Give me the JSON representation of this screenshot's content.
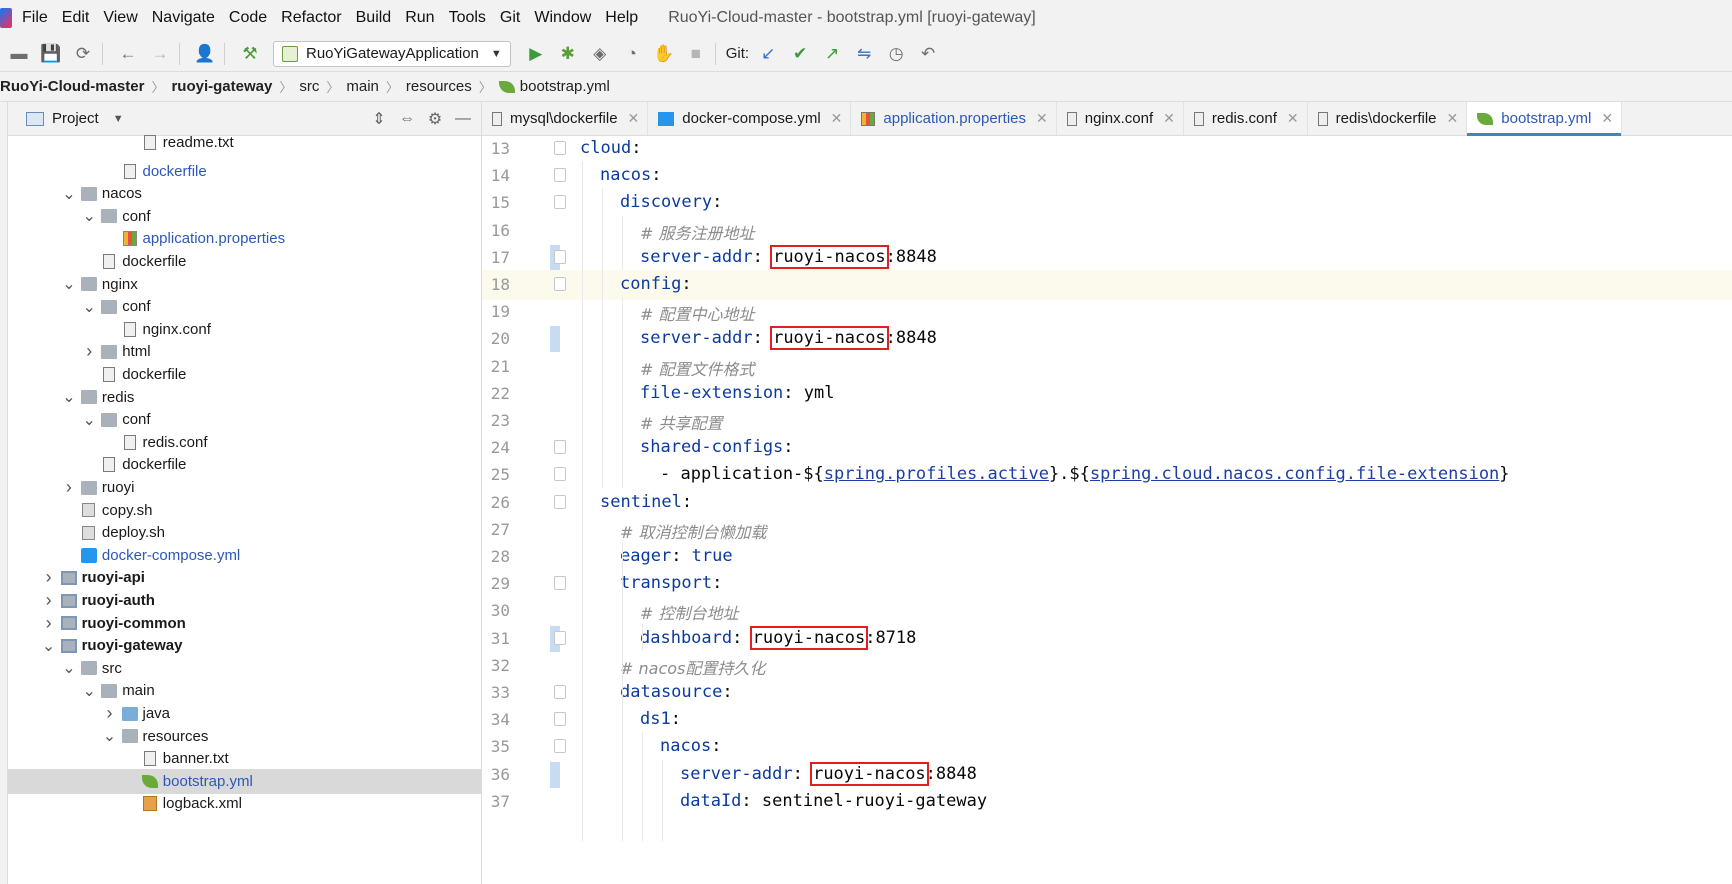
{
  "menu": [
    "File",
    "Edit",
    "View",
    "Navigate",
    "Code",
    "Refactor",
    "Build",
    "Run",
    "Tools",
    "Git",
    "Window",
    "Help"
  ],
  "window_title": "RuoYi-Cloud-master - bootstrap.yml [ruoyi-gateway]",
  "toolbar": {
    "run_config": "RuoYiGatewayApplication",
    "git_label": "Git:"
  },
  "breadcrumb": [
    "RuoYi-Cloud-master",
    "ruoyi-gateway",
    "src",
    "main",
    "resources",
    "bootstrap.yml"
  ],
  "project_panel": {
    "title": "Project",
    "tree": [
      {
        "label": "readme.txt",
        "depth": 6,
        "icon": "file",
        "arrow": ""
      },
      {
        "label": "dockerfile",
        "depth": 5,
        "icon": "file",
        "arrow": "",
        "style": "blue"
      },
      {
        "label": "nacos",
        "depth": 3,
        "icon": "folder",
        "arrow": "v"
      },
      {
        "label": "conf",
        "depth": 4,
        "icon": "folder",
        "arrow": "v"
      },
      {
        "label": "application.properties",
        "depth": 5,
        "icon": "props",
        "arrow": "",
        "style": "blue"
      },
      {
        "label": "dockerfile",
        "depth": 4,
        "icon": "file",
        "arrow": ""
      },
      {
        "label": "nginx",
        "depth": 3,
        "icon": "folder",
        "arrow": "v"
      },
      {
        "label": "conf",
        "depth": 4,
        "icon": "folder",
        "arrow": "v"
      },
      {
        "label": "nginx.conf",
        "depth": 5,
        "icon": "file",
        "arrow": ""
      },
      {
        "label": "html",
        "depth": 4,
        "icon": "folder",
        "arrow": ">"
      },
      {
        "label": "dockerfile",
        "depth": 4,
        "icon": "file",
        "arrow": ""
      },
      {
        "label": "redis",
        "depth": 3,
        "icon": "folder",
        "arrow": "v"
      },
      {
        "label": "conf",
        "depth": 4,
        "icon": "folder",
        "arrow": "v"
      },
      {
        "label": "redis.conf",
        "depth": 5,
        "icon": "file",
        "arrow": ""
      },
      {
        "label": "dockerfile",
        "depth": 4,
        "icon": "file",
        "arrow": ""
      },
      {
        "label": "ruoyi",
        "depth": 3,
        "icon": "folder",
        "arrow": ">"
      },
      {
        "label": "copy.sh",
        "depth": 3,
        "icon": "sh",
        "arrow": ""
      },
      {
        "label": "deploy.sh",
        "depth": 3,
        "icon": "sh",
        "arrow": ""
      },
      {
        "label": "docker-compose.yml",
        "depth": 3,
        "icon": "dc",
        "arrow": "",
        "style": "blue"
      },
      {
        "label": "ruoyi-api",
        "depth": 2,
        "icon": "module",
        "arrow": ">",
        "style": "bold"
      },
      {
        "label": "ruoyi-auth",
        "depth": 2,
        "icon": "module",
        "arrow": ">",
        "style": "bold"
      },
      {
        "label": "ruoyi-common",
        "depth": 2,
        "icon": "module",
        "arrow": ">",
        "style": "bold"
      },
      {
        "label": "ruoyi-gateway",
        "depth": 2,
        "icon": "module",
        "arrow": "v",
        "style": "bold"
      },
      {
        "label": "src",
        "depth": 3,
        "icon": "folder",
        "arrow": "v"
      },
      {
        "label": "main",
        "depth": 4,
        "icon": "folder",
        "arrow": "v"
      },
      {
        "label": "java",
        "depth": 5,
        "icon": "folder-blue",
        "arrow": ">"
      },
      {
        "label": "resources",
        "depth": 5,
        "icon": "folder",
        "arrow": "v"
      },
      {
        "label": "banner.txt",
        "depth": 6,
        "icon": "file",
        "arrow": ""
      },
      {
        "label": "bootstrap.yml",
        "depth": 6,
        "icon": "yml",
        "arrow": "",
        "style": "blue",
        "selected": true
      },
      {
        "label": "logback.xml",
        "depth": 6,
        "icon": "xml",
        "arrow": ""
      }
    ]
  },
  "tabs": [
    {
      "label": "mysql\\dockerfile",
      "icon": "file"
    },
    {
      "label": "docker-compose.yml",
      "icon": "dc"
    },
    {
      "label": "application.properties",
      "icon": "props"
    },
    {
      "label": "nginx.conf",
      "icon": "file"
    },
    {
      "label": "redis.conf",
      "icon": "file"
    },
    {
      "label": "redis\\dockerfile",
      "icon": "file"
    },
    {
      "label": "bootstrap.yml",
      "icon": "yml",
      "active": true
    }
  ],
  "editor": {
    "lines": [
      {
        "n": "13",
        "indent": 2,
        "parts": [
          [
            "k",
            "cloud"
          ],
          [
            "v",
            ":"
          ]
        ],
        "fold": true
      },
      {
        "n": "14",
        "indent": 3,
        "parts": [
          [
            "k",
            "nacos"
          ],
          [
            "v",
            ":"
          ]
        ],
        "fold": true
      },
      {
        "n": "15",
        "indent": 4,
        "parts": [
          [
            "k",
            "discovery"
          ],
          [
            "v",
            ":"
          ]
        ],
        "fold": true
      },
      {
        "n": "16",
        "indent": 5,
        "parts": [
          [
            "c",
            "# 服务注册地址"
          ]
        ]
      },
      {
        "n": "17",
        "indent": 5,
        "parts": [
          [
            "k",
            "server-addr"
          ],
          [
            "v",
            ": "
          ],
          [
            "box",
            "ruoyi-nacos"
          ],
          [
            "v",
            ":8848"
          ]
        ],
        "fold": true,
        "change": true
      },
      {
        "n": "18",
        "indent": 4,
        "parts": [
          [
            "k",
            "config"
          ],
          [
            "v",
            ":"
          ]
        ],
        "fold": true,
        "hl": true
      },
      {
        "n": "19",
        "indent": 5,
        "parts": [
          [
            "c",
            "# 配置中心地址"
          ]
        ]
      },
      {
        "n": "20",
        "indent": 5,
        "parts": [
          [
            "k",
            "server-addr"
          ],
          [
            "v",
            ": "
          ],
          [
            "box",
            "ruoyi-nacos"
          ],
          [
            "v",
            ":8848"
          ]
        ],
        "change": true
      },
      {
        "n": "21",
        "indent": 5,
        "parts": [
          [
            "c",
            "# 配置文件格式"
          ]
        ]
      },
      {
        "n": "22",
        "indent": 5,
        "parts": [
          [
            "k",
            "file-extension"
          ],
          [
            "v",
            ": yml"
          ]
        ]
      },
      {
        "n": "23",
        "indent": 5,
        "parts": [
          [
            "c",
            "# 共享配置"
          ]
        ]
      },
      {
        "n": "24",
        "indent": 5,
        "parts": [
          [
            "k",
            "shared-configs"
          ],
          [
            "v",
            ":"
          ]
        ],
        "fold": true
      },
      {
        "n": "25",
        "indent": 6,
        "parts": [
          [
            "v",
            "- application-${"
          ],
          [
            "u",
            "spring.profiles.active"
          ],
          [
            "v",
            "}.${"
          ],
          [
            "u",
            "spring.cloud.nacos.config.file-extension"
          ],
          [
            "v",
            "}"
          ]
        ],
        "fold": true
      },
      {
        "n": "26",
        "indent": 3,
        "parts": [
          [
            "k",
            "sentinel"
          ],
          [
            "v",
            ":"
          ]
        ],
        "fold": true
      },
      {
        "n": "27",
        "indent": 4,
        "parts": [
          [
            "c",
            "# 取消控制台懒加载"
          ]
        ]
      },
      {
        "n": "28",
        "indent": 4,
        "parts": [
          [
            "k",
            "eager"
          ],
          [
            "v",
            ": "
          ],
          [
            "k",
            "true"
          ]
        ]
      },
      {
        "n": "29",
        "indent": 4,
        "parts": [
          [
            "k",
            "transport"
          ],
          [
            "v",
            ":"
          ]
        ],
        "fold": true
      },
      {
        "n": "30",
        "indent": 5,
        "parts": [
          [
            "c",
            "# 控制台地址"
          ]
        ]
      },
      {
        "n": "31",
        "indent": 5,
        "parts": [
          [
            "k",
            "dashboard"
          ],
          [
            "v",
            ": "
          ],
          [
            "box",
            "ruoyi-nacos"
          ],
          [
            "v",
            ":8718"
          ]
        ],
        "fold": true,
        "change": true
      },
      {
        "n": "32",
        "indent": 4,
        "parts": [
          [
            "c",
            "# nacos配置持久化"
          ]
        ]
      },
      {
        "n": "33",
        "indent": 4,
        "parts": [
          [
            "k",
            "datasource"
          ],
          [
            "v",
            ":"
          ]
        ],
        "fold": true
      },
      {
        "n": "34",
        "indent": 5,
        "parts": [
          [
            "k",
            "ds1"
          ],
          [
            "v",
            ":"
          ]
        ],
        "fold": true
      },
      {
        "n": "35",
        "indent": 6,
        "parts": [
          [
            "k",
            "nacos"
          ],
          [
            "v",
            ":"
          ]
        ],
        "fold": true
      },
      {
        "n": "36",
        "indent": 7,
        "parts": [
          [
            "k",
            "server-addr"
          ],
          [
            "v",
            ": "
          ],
          [
            "box",
            "ruoyi-nacos"
          ],
          [
            "v",
            ":8848"
          ]
        ],
        "change": true
      },
      {
        "n": "37",
        "indent": 7,
        "parts": [
          [
            "k",
            "dataId"
          ],
          [
            "v",
            ": sentinel-ruoyi-gateway"
          ]
        ]
      }
    ]
  },
  "colors": {
    "keyword": "#0b3a9e",
    "comment": "#8c8c8c",
    "highlight_box": "#e02020",
    "active_tab_underline": "#4083c9"
  }
}
